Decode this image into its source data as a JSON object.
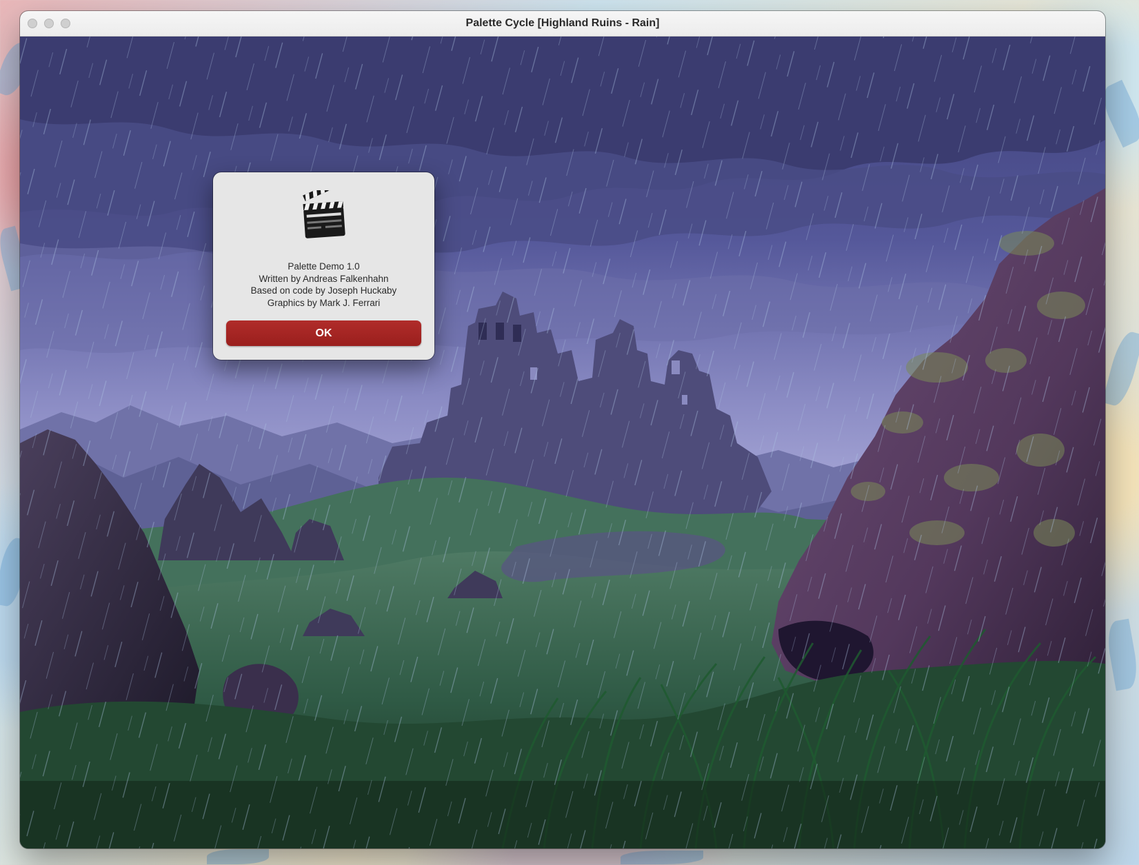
{
  "window": {
    "title": "Palette Cycle [Highland Ruins - Rain]"
  },
  "traffic_lights": [
    "close-button",
    "minimize-button",
    "zoom-button"
  ],
  "scene": {
    "name": "Highland Ruins",
    "weather": "Rain",
    "colors": {
      "sky": "#4d5291",
      "sky_light": "#9a9bd0",
      "mountains": "#6f73a6",
      "castle": "#4e4c7a",
      "grass": "#2f5a45",
      "grass_dark": "#1b3a27",
      "rock": "#5a3f63",
      "rain": "#9ab3d6"
    }
  },
  "dialog": {
    "icon": "clapperboard-icon",
    "lines": [
      "Palette Demo 1.0",
      "Written by Andreas Falkenhahn",
      "Based on code by Joseph Huckaby",
      "Graphics by Mark J. Ferrari"
    ],
    "ok_label": "OK",
    "accent": "#a3231f"
  }
}
